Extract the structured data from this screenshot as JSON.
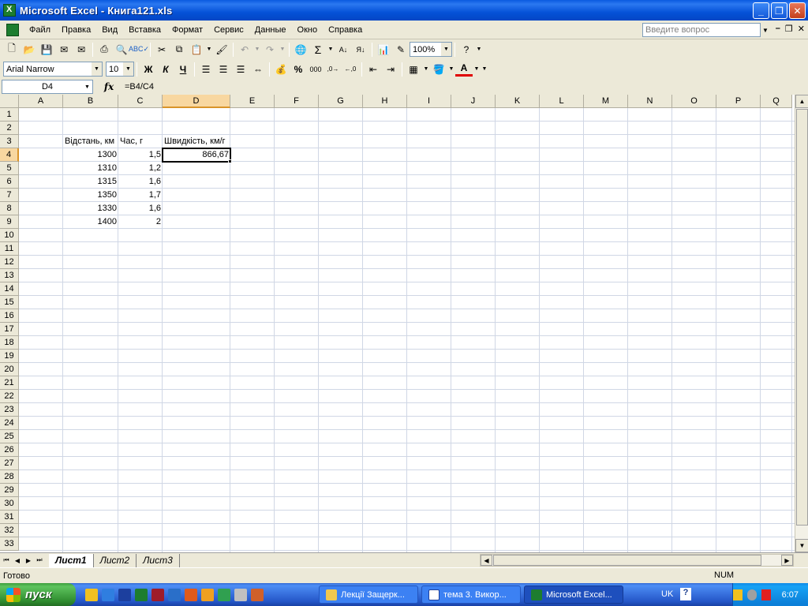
{
  "window": {
    "title": "Microsoft Excel - Книга121.xls"
  },
  "menu": {
    "items": [
      "Файл",
      "Правка",
      "Вид",
      "Вставка",
      "Формат",
      "Сервис",
      "Данные",
      "Окно",
      "Справка"
    ],
    "ask_placeholder": "Введите вопрос"
  },
  "toolbar": {
    "zoom": "100%",
    "font_name": "Arial Narrow",
    "font_size": "10",
    "bold_label": "Ж",
    "italic_label": "К",
    "underline_label": "Ч",
    "percent_label": "%",
    "thousands_label": "000",
    "sigma_label": "Σ"
  },
  "formula_bar": {
    "name_box": "D4",
    "fx_label": "fx",
    "formula": "=B4/C4"
  },
  "grid": {
    "columns": [
      "A",
      "B",
      "C",
      "D",
      "E",
      "F",
      "G",
      "H",
      "I",
      "J",
      "K",
      "L",
      "M",
      "N",
      "O",
      "P",
      "Q"
    ],
    "row_count": 33,
    "active_cell": {
      "column": "D",
      "row": 4
    },
    "cells": {
      "B3": "Відстань, км",
      "C3": "Час, г",
      "D3": "Швидкість, км/г",
      "B4": "1300",
      "C4": "1,5",
      "D4": "866,67",
      "B5": "1310",
      "C5": "1,2",
      "B6": "1315",
      "C6": "1,6",
      "B7": "1350",
      "C7": "1,7",
      "B8": "1330",
      "C8": "1,6",
      "B9": "1400",
      "C9": "2"
    }
  },
  "sheets": {
    "tabs": [
      "Лист1",
      "Лист2",
      "Лист3"
    ],
    "active": "Лист1"
  },
  "status": {
    "text": "Готово",
    "num": "NUM"
  },
  "taskbar": {
    "start_label": "пуск",
    "tasks": [
      "Лекції Защерк...",
      "тема 3. Викор...",
      "Microsoft Excel..."
    ],
    "active_task": "Microsoft Excel...",
    "lang": "UK",
    "clock": "6:07"
  }
}
